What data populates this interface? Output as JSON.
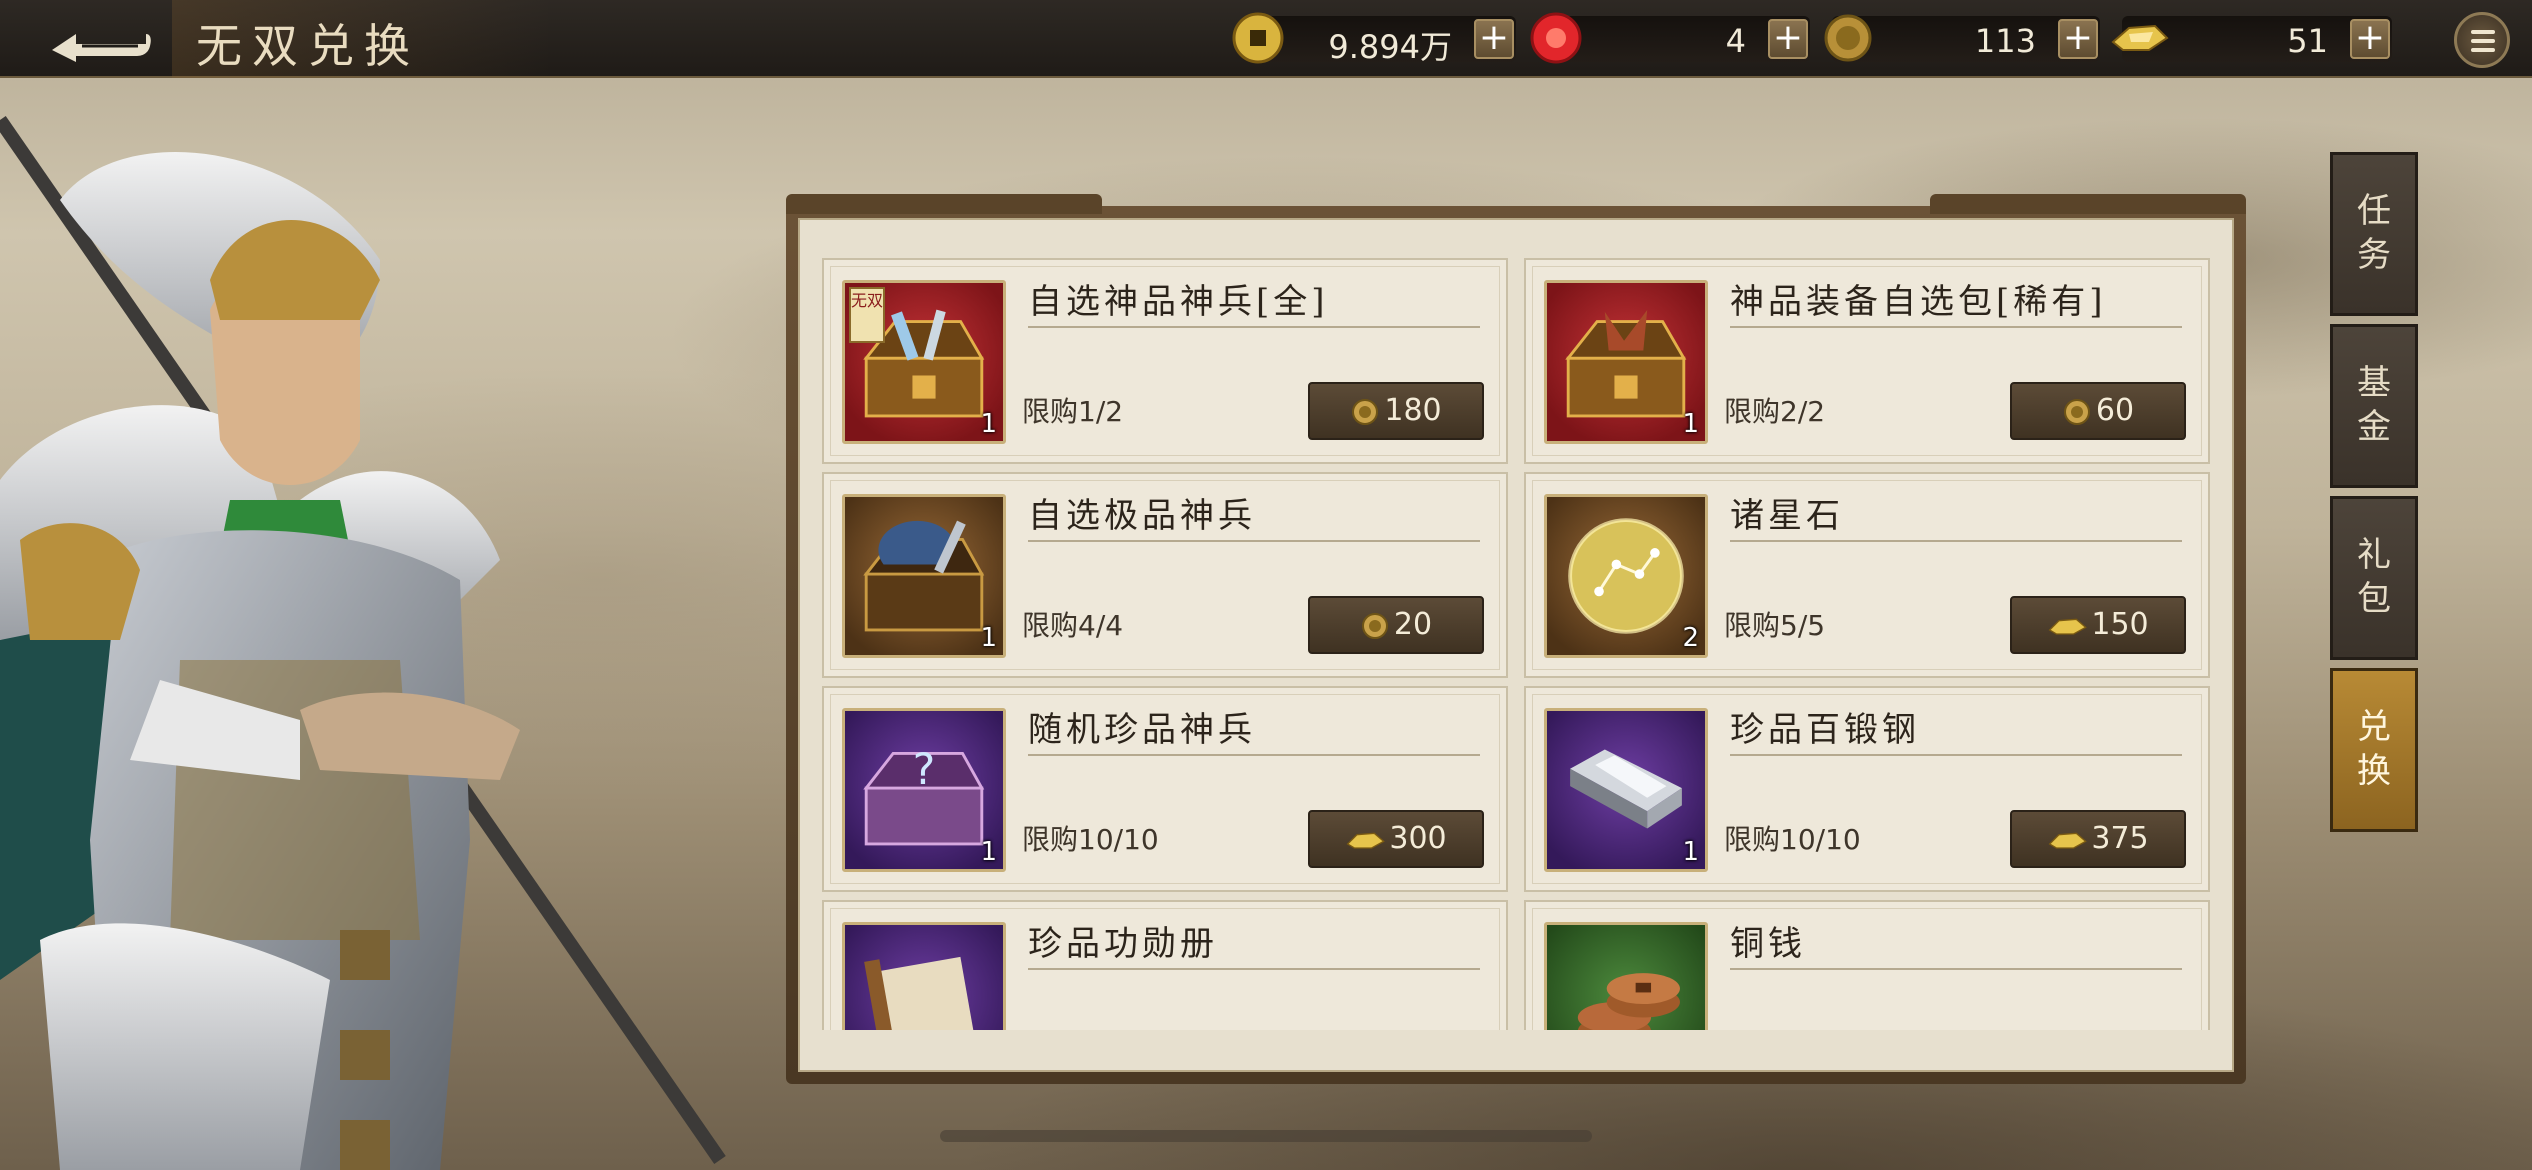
{
  "header": {
    "title": "无双兑换",
    "back_icon": "back-arrow-icon"
  },
  "resources": [
    {
      "icon": "copper-coin-icon",
      "value": "9.894万"
    },
    {
      "icon": "red-jade-icon",
      "value": "4"
    },
    {
      "icon": "gold-coin-icon",
      "value": "113"
    },
    {
      "icon": "gold-ingot-icon",
      "value": "51"
    }
  ],
  "side_tabs": [
    {
      "label": "任务",
      "active": false
    },
    {
      "label": "基金",
      "active": false
    },
    {
      "label": "礼包",
      "active": false
    },
    {
      "label": "兑换",
      "active": true
    }
  ],
  "shop_items": [
    {
      "name": "自选神品神兵[全]",
      "limit": "限购1/2",
      "price": "180",
      "currency": "gold-coin-icon",
      "qty": "1",
      "badge": "无双",
      "bg": "red"
    },
    {
      "name": "神品装备自选包[稀有]",
      "limit": "限购2/2",
      "price": "60",
      "currency": "gold-coin-icon",
      "qty": "1",
      "bg": "red"
    },
    {
      "name": "自选极品神兵",
      "limit": "限购4/4",
      "price": "20",
      "currency": "gold-coin-icon",
      "qty": "1",
      "bg": "brown"
    },
    {
      "name": "诸星石",
      "limit": "限购5/5",
      "price": "150",
      "currency": "gold-ingot-icon",
      "qty": "2",
      "bg": "brown"
    },
    {
      "name": "随机珍品神兵",
      "limit": "限购10/10",
      "price": "300",
      "currency": "gold-ingot-icon",
      "qty": "1",
      "bg": "purple"
    },
    {
      "name": "珍品百锻钢",
      "limit": "限购10/10",
      "price": "375",
      "currency": "gold-ingot-icon",
      "qty": "1",
      "bg": "purple"
    },
    {
      "name": "珍品功勋册",
      "limit": "",
      "price": "",
      "currency": "",
      "qty": "",
      "bg": "purple"
    },
    {
      "name": "铜钱",
      "limit": "",
      "price": "",
      "currency": "",
      "qty": "",
      "bg": "green"
    }
  ]
}
